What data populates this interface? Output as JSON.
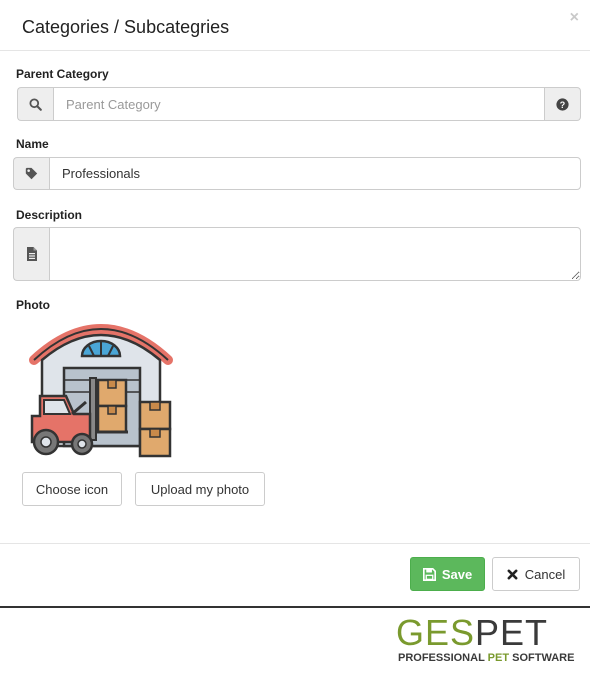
{
  "modal": {
    "title": "Categories / Subcategries",
    "close_label": "×"
  },
  "form": {
    "parent_category": {
      "label": "Parent Category",
      "placeholder": "Parent Category",
      "value": ""
    },
    "name": {
      "label": "Name",
      "value": "Professionals"
    },
    "description": {
      "label": "Description",
      "value": ""
    },
    "photo": {
      "label": "Photo",
      "image_icon": "warehouse-forklift-icon"
    }
  },
  "buttons": {
    "choose_icon": "Choose icon",
    "upload_photo": "Upload my photo",
    "save": "Save",
    "cancel": "Cancel"
  },
  "brand": {
    "word_part1": "GES",
    "word_part2": "PET",
    "tagline_part1": "PROFESSIONAL ",
    "tagline_part2": "PET",
    "tagline_part3": " SOFTWARE",
    "accent_color": "#7a9a2e",
    "dark_color": "#3a3a3a"
  },
  "colors": {
    "save_green": "#5cb85c",
    "addon_gray": "#eeeeee",
    "border": "#cccccc"
  }
}
